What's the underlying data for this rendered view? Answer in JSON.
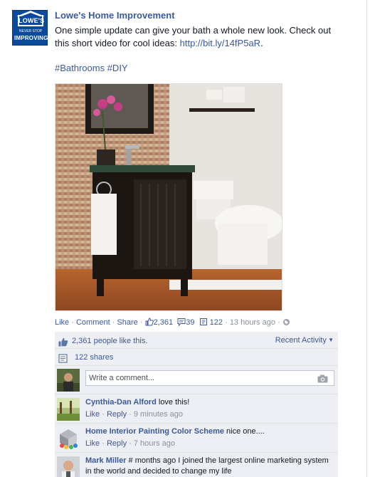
{
  "page": {
    "name": "Lowe's Home Improvement",
    "logo": {
      "brand": "LOWE'S",
      "tag_small": "NEVER STOP",
      "tag_large": "IMPROVING"
    }
  },
  "post": {
    "message": "One simple update can give your bath a whole new look. Check out this short video for cool ideas:",
    "link": "http://bit.ly/14fP5aR",
    "link_suffix": ".",
    "hashtags": "#Bathrooms #DIY"
  },
  "actions": {
    "like": "Like",
    "comment": "Comment",
    "share": "Share",
    "like_count": "2,361",
    "comment_count": "39",
    "share_count": "122",
    "timestamp": "13 hours ago",
    "separator": " · "
  },
  "ufi": {
    "likes_text": "2,361 people like this.",
    "sort_label": "Recent Activity",
    "shares_text": "122 shares",
    "compose_placeholder": "Write a comment...",
    "comments": [
      {
        "author": "Cynthia-Dan Alford",
        "text": "love this!",
        "like": "Like",
        "reply": "Reply",
        "time": "9 minutes ago"
      },
      {
        "author": "Home Interior Painting Color Scheme",
        "text": "nice one....",
        "like": "Like",
        "reply": "Reply",
        "time": "7 hours ago"
      },
      {
        "author": "Mark Miller",
        "text": "# months ago I joined the largest online marketing system in the world and decided to change my life"
      }
    ]
  },
  "colors": {
    "link": "#3b5998",
    "brand_blue": "#0b4a9b",
    "muted": "#89919c",
    "ufi_bg": "#edeff4"
  }
}
